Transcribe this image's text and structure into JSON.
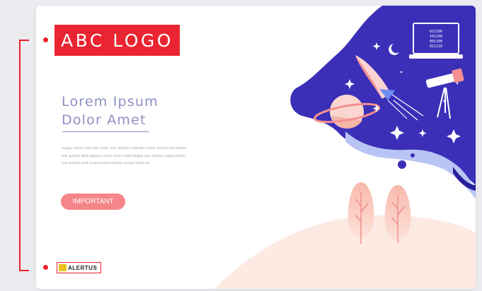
{
  "logo": {
    "text": "ABC LOGO"
  },
  "hero": {
    "title_line1": "Lorem Ipsum",
    "title_line2": "Dolor Amet",
    "body": "Congue primis class felis sociis, nam ridiculus imperdiet. Primis dictumst per laoreet felis, gravida tellus dapibus. Auctor sociis cubilia feugiat cras, tristique magna ultrices. Erat vivamus taciti congue laoreet montes, suscipit varius dui.",
    "button_label": "IMPORTANT"
  },
  "footer": {
    "brand": "ALERTUS"
  },
  "illustration": {
    "laptop_code": [
      "011100",
      "101100",
      "001100",
      "011110"
    ]
  },
  "colors": {
    "accent": "#ea2430",
    "button": "#f48588",
    "title": "#8d90c2",
    "space": "#3b2fb8"
  }
}
